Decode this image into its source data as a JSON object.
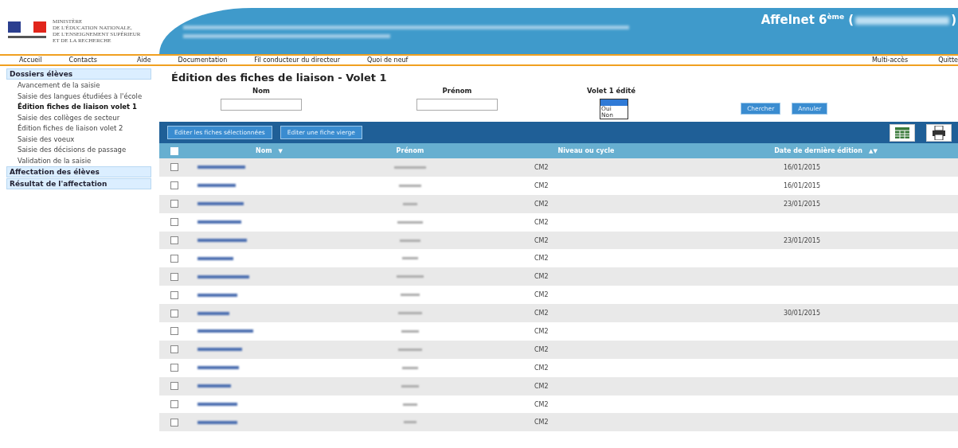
{
  "header": {
    "ministry": [
      "MINISTÈRE",
      "DE L'ÉDUCATION NATIONALE,",
      "DE L'ENSEIGNEMENT SUPÉRIEUR",
      "ET DE LA RECHERCHE"
    ],
    "app_title": "Affelnet 6$^{ème}$ (",
    "app_title_end": ")"
  },
  "nav": {
    "left": [
      "Accueil",
      "Contacts",
      "Aide",
      "Documentation",
      "Fil conducteur du directeur",
      "Quoi de neuf"
    ],
    "right": [
      "Multi-accès",
      "Quitte"
    ]
  },
  "sidebar": [
    {
      "label": "Dossiers élèves",
      "items": [
        {
          "label": "Avancement de la saisie",
          "selected": false
        },
        {
          "label": "Saisie des langues étudiées à l'école",
          "selected": false
        },
        {
          "label": "Édition fiches de liaison volet 1",
          "selected": true
        },
        {
          "label": "Saisie des collèges de secteur",
          "selected": false
        },
        {
          "label": "Édition fiches de liaison volet 2",
          "selected": false
        },
        {
          "label": "Saisie des voeux",
          "selected": false
        },
        {
          "label": "Saisie des décisions de passage",
          "selected": false
        },
        {
          "label": "Validation de la saisie",
          "selected": false
        }
      ]
    },
    {
      "label": "Affectation des élèves"
    },
    {
      "label": "Résultat de l'affectation"
    }
  ],
  "page_title": "Édition des fiches de liaison - Volet 1",
  "filters": {
    "nom_label": "Nom",
    "prenom_label": "Prénom",
    "volet_label": "Volet 1 édité",
    "volet_options": [
      {
        "selected": true
      },
      {
        "label": "Oui",
        "selected": false
      },
      {
        "label": "Non",
        "selected": false
      }
    ],
    "buttons": [
      "Chercher",
      "Annuler"
    ]
  },
  "toolbar": {
    "buttons": [
      "Editer les fiches sélectionnées",
      "Editer une fiche vierge"
    ]
  },
  "table": {
    "select_all_checked": false,
    "columns": [
      {
        "label": "Nom",
        "sort": "▼"
      },
      {
        "label": "Prénom"
      },
      {
        "label": "Niveau ou cycle"
      },
      {
        "label": "Date de dernière édition",
        "sort": "▲▼"
      }
    ],
    "rows": [
      {
        "checked": false,
        "level": "CM2",
        "date": "16/01/2015"
      },
      {
        "checked": false,
        "level": "CM2",
        "date": "16/01/2015"
      },
      {
        "checked": false,
        "level": "CM2",
        "date": "23/01/2015"
      },
      {
        "checked": false,
        "level": "CM2"
      },
      {
        "checked": false,
        "level": "CM2",
        "date": "23/01/2015"
      },
      {
        "checked": false,
        "level": "CM2"
      },
      {
        "checked": false,
        "level": "CM2"
      },
      {
        "checked": false,
        "level": "CM2"
      },
      {
        "checked": false,
        "level": "CM2",
        "date": "30/01/2015"
      },
      {
        "checked": false,
        "level": "CM2"
      },
      {
        "checked": false,
        "level": "CM2"
      },
      {
        "checked": false,
        "level": "CM2"
      },
      {
        "checked": false,
        "level": "CM2"
      },
      {
        "checked": false,
        "level": "CM2"
      },
      {
        "checked": false,
        "level": "CM2"
      }
    ]
  }
}
